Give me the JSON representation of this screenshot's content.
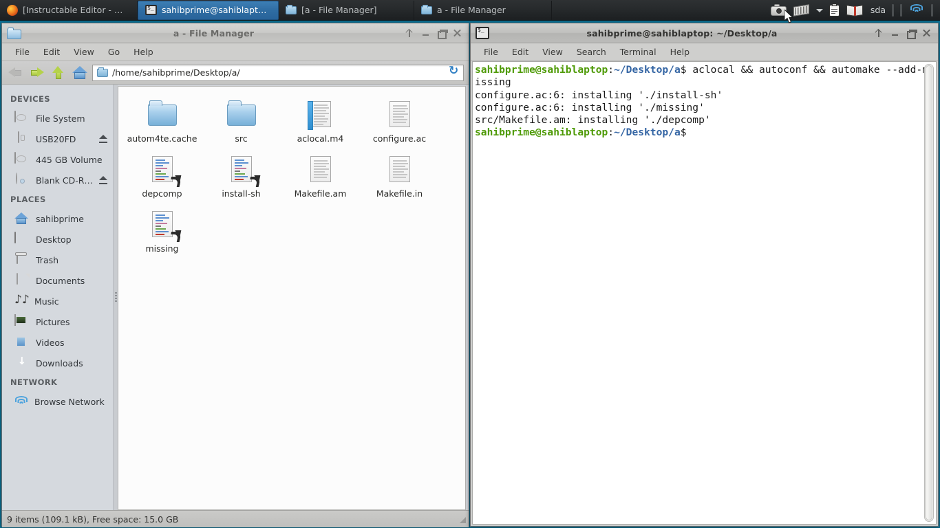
{
  "taskbar": {
    "buttons": [
      {
        "label": "[Instructable Editor - Mo...",
        "icon": "firefox-icon",
        "active": false
      },
      {
        "label": "sahibprime@sahiblapto...",
        "icon": "terminal-icon",
        "active": true
      },
      {
        "label": "[a - File Manager]",
        "icon": "folder-icon",
        "active": false
      },
      {
        "label": "a - File Manager",
        "icon": "folder-icon",
        "active": false
      }
    ],
    "tray": {
      "items": [
        {
          "name": "camera-icon",
          "label": ""
        },
        {
          "name": "keyboard-layout-icon",
          "label": ""
        },
        {
          "name": "chevron-down-icon",
          "label": ""
        },
        {
          "name": "clipboard-icon",
          "label": ""
        },
        {
          "name": "dictionary-icon",
          "label": ""
        },
        {
          "name": "disk-mount-label",
          "label": "sda"
        },
        {
          "name": "network-wifi-icon",
          "label": ""
        }
      ],
      "disk_label": "sda"
    }
  },
  "file_manager": {
    "title": "a - File Manager",
    "window_icon": "folder-icon",
    "window_buttons": [
      "shade",
      "minimize",
      "maximize",
      "close"
    ],
    "menu": [
      "File",
      "Edit",
      "View",
      "Go",
      "Help"
    ],
    "toolbar": {
      "back": "back-button",
      "forward": "forward-button",
      "up": "up-button",
      "home": "home-button",
      "path": "/home/sahibprime/Desktop/a/",
      "reload": "reload-button"
    },
    "sidebar": {
      "sections": [
        {
          "heading": "DEVICES",
          "items": [
            {
              "label": "File System",
              "icon": "harddisk-icon",
              "eject": false
            },
            {
              "label": "USB20FD",
              "icon": "usb-drive-icon",
              "eject": true
            },
            {
              "label": "445 GB Volume",
              "icon": "harddisk-icon",
              "eject": false
            },
            {
              "label": "Blank CD-R ...",
              "icon": "cd-disc-icon",
              "eject": true
            }
          ]
        },
        {
          "heading": "PLACES",
          "items": [
            {
              "label": "sahibprime",
              "icon": "home-icon",
              "eject": false
            },
            {
              "label": "Desktop",
              "icon": "desktop-icon",
              "eject": false
            },
            {
              "label": "Trash",
              "icon": "trash-icon",
              "eject": false
            },
            {
              "label": "Documents",
              "icon": "document-icon",
              "eject": false
            },
            {
              "label": "Music",
              "icon": "music-icon",
              "eject": false
            },
            {
              "label": "Pictures",
              "icon": "pictures-icon",
              "eject": false
            },
            {
              "label": "Videos",
              "icon": "video-icon",
              "eject": false
            },
            {
              "label": "Downloads",
              "icon": "downloads-icon",
              "eject": false
            }
          ]
        },
        {
          "heading": "NETWORK",
          "items": [
            {
              "label": "Browse Network",
              "icon": "network-icon",
              "eject": false
            }
          ]
        }
      ]
    },
    "files": [
      {
        "name": "autom4te.cache",
        "kind": "folder"
      },
      {
        "name": "src",
        "kind": "folder"
      },
      {
        "name": "aclocal.m4",
        "kind": "document-accent"
      },
      {
        "name": "configure.ac",
        "kind": "document"
      },
      {
        "name": "depcomp",
        "kind": "script-link"
      },
      {
        "name": "install-sh",
        "kind": "script-link"
      },
      {
        "name": "Makefile.am",
        "kind": "document"
      },
      {
        "name": "Makefile.in",
        "kind": "document"
      },
      {
        "name": "missing",
        "kind": "script-link"
      }
    ],
    "status": "9 items (109.1 kB), Free space: 15.0 GB"
  },
  "terminal": {
    "title": "sahibprime@sahiblaptop: ~/Desktop/a",
    "window_icon": "terminal-icon",
    "menu": [
      "File",
      "Edit",
      "View",
      "Search",
      "Terminal",
      "Help"
    ],
    "lines": [
      {
        "user": "sahibprime@sahiblaptop",
        "path": "~/Desktop/a",
        "prompt": "$ ",
        "text": "aclocal && autoconf && automake --add-missing"
      },
      {
        "user": "",
        "path": "",
        "prompt": "",
        "text": "configure.ac:6: installing './install-sh'"
      },
      {
        "user": "",
        "path": "",
        "prompt": "",
        "text": "configure.ac:6: installing './missing'"
      },
      {
        "user": "",
        "path": "",
        "prompt": "",
        "text": "src/Makefile.am: installing './depcomp'"
      },
      {
        "user": "sahibprime@sahiblaptop",
        "path": "~/Desktop/a",
        "prompt": "$",
        "text": ""
      }
    ]
  },
  "colors": {
    "desktop": "#0b7296",
    "taskbar": "#26292b",
    "taskbar_active": "#2f6da3",
    "prompt_user": "#4e9a06",
    "prompt_path": "#3465a4"
  }
}
